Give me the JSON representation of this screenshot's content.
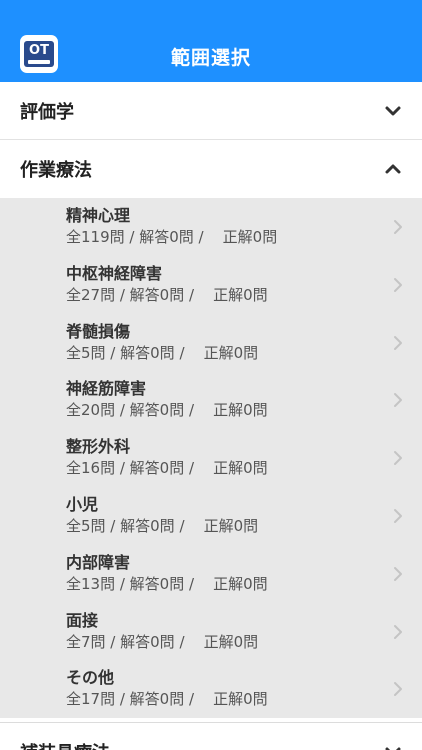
{
  "header": {
    "title": "範囲選択",
    "app_icon_text": "OT"
  },
  "sections": [
    {
      "title": "評価学",
      "state": "collapsed"
    },
    {
      "title": "作業療法",
      "state": "expanded"
    },
    {
      "title": "補装具療法",
      "state": "collapsed"
    }
  ],
  "subitems": [
    {
      "title": "精神心理",
      "stats": "全119問 / 解答0問 /    正解0問"
    },
    {
      "title": "中枢神経障害",
      "stats": "全27問 / 解答0問 /    正解0問"
    },
    {
      "title": "脊髄損傷",
      "stats": "全5問 / 解答0問 /    正解0問"
    },
    {
      "title": "神経筋障害",
      "stats": "全20問 / 解答0問 /    正解0問"
    },
    {
      "title": "整形外科",
      "stats": "全16問 / 解答0問 /    正解0問"
    },
    {
      "title": "小児",
      "stats": "全5問 / 解答0問 /    正解0問"
    },
    {
      "title": "内部障害",
      "stats": "全13問 / 解答0問 /    正解0問"
    },
    {
      "title": "面接",
      "stats": "全7問 / 解答0問 /    正解0問"
    },
    {
      "title": "その他",
      "stats": "全17問 / 解答0問 /    正解0問"
    }
  ],
  "colors": {
    "accent": "#1E90FF",
    "list_bg": "#E8E8E8"
  }
}
